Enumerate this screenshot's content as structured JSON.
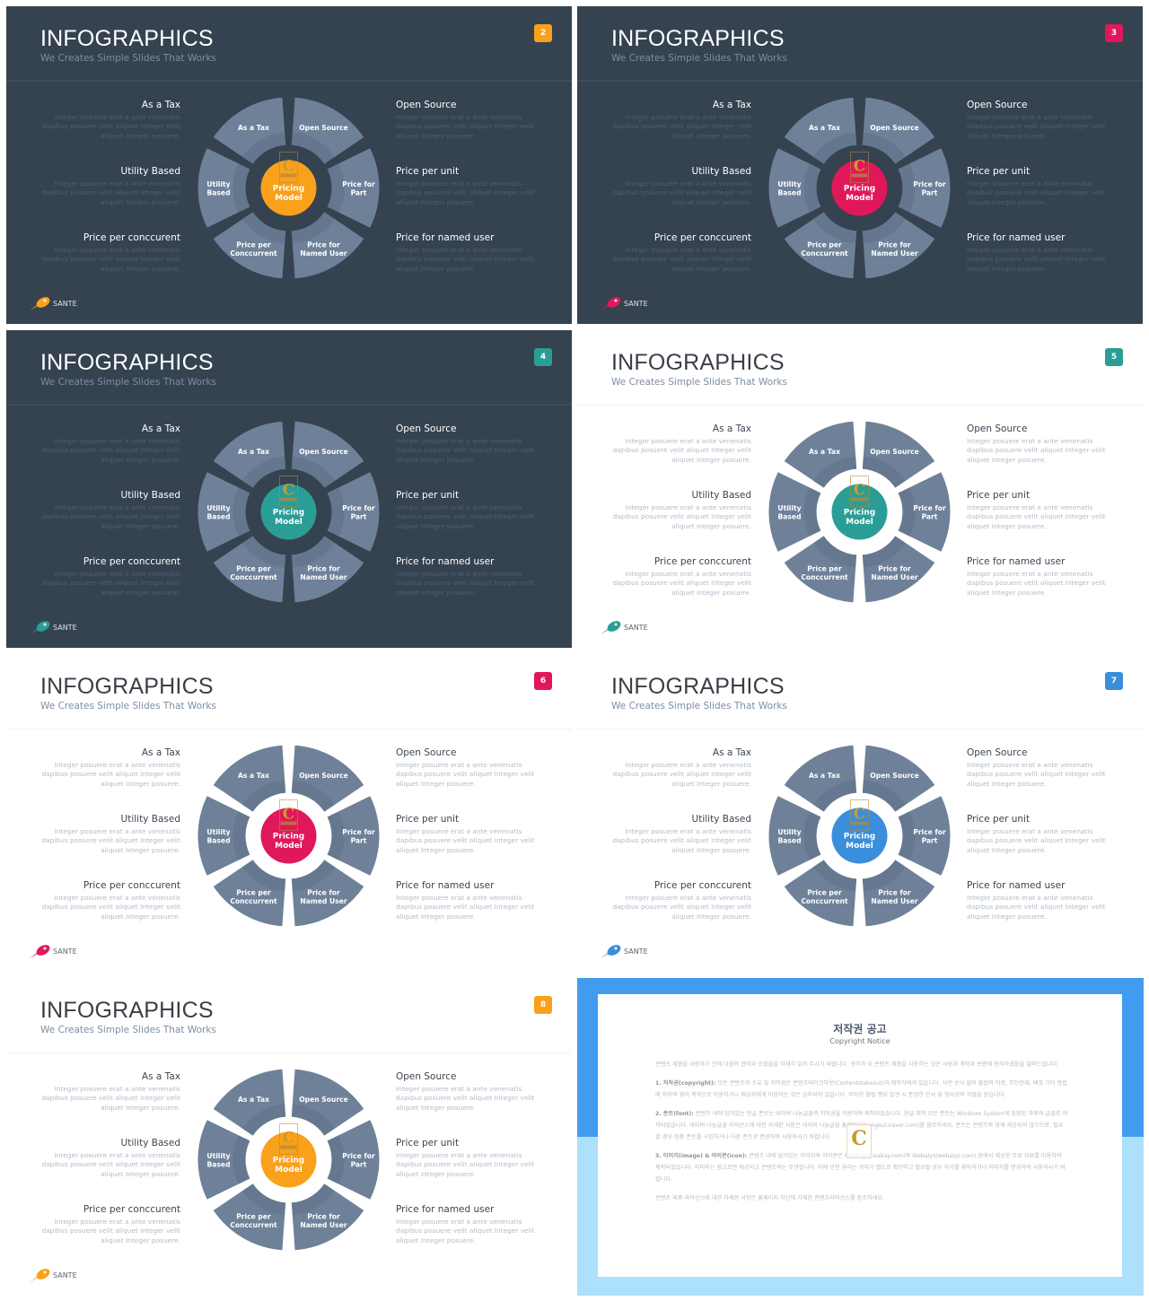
{
  "deck": {
    "segment_color": "#6E8199",
    "dark_bg": "#354250",
    "logo_c_color": "#C99A32"
  },
  "slides": [
    {
      "number": "2",
      "theme": "dark",
      "accent": "#F9A11B",
      "title": "INFOGRAPHICS",
      "subtitle": "We Creates Simple Slides That Works",
      "center_label": [
        "Pricing",
        "Model"
      ],
      "segments": [
        {
          "label": [
            "As a Tax"
          ]
        },
        {
          "label": [
            "Open Source"
          ]
        },
        {
          "label": [
            "Price for",
            "Part"
          ]
        },
        {
          "label": [
            "Price for",
            "Named User"
          ]
        },
        {
          "label": [
            "Price per",
            "Conccurrent"
          ]
        },
        {
          "label": [
            "Utility",
            "Based"
          ]
        }
      ],
      "left_items": [
        {
          "heading": "As a Tax",
          "body": "Integer posuere erat a ante venenatis dapibus posuere velit aliquet Integer velit aliquet Integer posuere."
        },
        {
          "heading": "Utility Based",
          "body": "Integer posuere erat a ante venenatis dapibus posuere velit aliquet Integer velit aliquet Integer posuere."
        },
        {
          "heading": "Price per conccurent",
          "body": "Integer posuere erat a ante venenatis dapibus posuere velit aliquet Integer velit aliquet Integer posuere."
        }
      ],
      "right_items": [
        {
          "heading": "Open Source",
          "body": "Integer posuere erat a ante venenatis dapibus posuere velit aliquet Integer velit aliquet Integer posuere."
        },
        {
          "heading": "Price per unit",
          "body": "Integer posuere erat a ante venenatis dapibus posuere velit aliquet Integer velit aliquet Integer posuere."
        },
        {
          "heading": "Price for named user",
          "body": "Integer posuere erat a ante venenatis dapibus posuere velit aliquet Integer velit aliquet Integer posuere."
        }
      ],
      "brand": "SANTE"
    },
    {
      "number": "3",
      "theme": "dark",
      "accent": "#E0185A",
      "title": "INFOGRAPHICS",
      "subtitle": "We Creates Simple Slides That Works",
      "center_label": [
        "Pricing",
        "Model"
      ],
      "segments": [
        {
          "label": [
            "As a Tax"
          ]
        },
        {
          "label": [
            "Open Source"
          ]
        },
        {
          "label": [
            "Price for",
            "Part"
          ]
        },
        {
          "label": [
            "Price for",
            "Named User"
          ]
        },
        {
          "label": [
            "Price per",
            "Conccurrent"
          ]
        },
        {
          "label": [
            "Utility",
            "Based"
          ]
        }
      ],
      "left_items": [
        {
          "heading": "As a Tax",
          "body": "Integer posuere erat a ante venenatis dapibus posuere velit aliquet Integer velit aliquet Integer posuere."
        },
        {
          "heading": "Utility Based",
          "body": "Integer posuere erat a ante venenatis dapibus posuere velit aliquet Integer velit aliquet Integer posuere."
        },
        {
          "heading": "Price per conccurent",
          "body": "Integer posuere erat a ante venenatis dapibus posuere velit aliquet Integer velit aliquet Integer posuere."
        }
      ],
      "right_items": [
        {
          "heading": "Open Source",
          "body": "Integer posuere erat a ante venenatis dapibus posuere velit aliquet Integer velit aliquet Integer posuere."
        },
        {
          "heading": "Price per unit",
          "body": "Integer posuere erat a ante venenatis dapibus posuere velit aliquet Integer velit aliquet Integer posuere."
        },
        {
          "heading": "Price for named user",
          "body": "Integer posuere erat a ante venenatis dapibus posuere velit aliquet Integer velit aliquet Integer posuere."
        }
      ],
      "brand": "SANTE"
    },
    {
      "number": "4",
      "theme": "dark",
      "accent": "#2A9D96",
      "title": "INFOGRAPHICS",
      "subtitle": "We Creates Simple Slides That Works",
      "center_label": [
        "Pricing",
        "Model"
      ],
      "segments": [
        {
          "label": [
            "As a Tax"
          ]
        },
        {
          "label": [
            "Open Source"
          ]
        },
        {
          "label": [
            "Price for",
            "Part"
          ]
        },
        {
          "label": [
            "Price for",
            "Named User"
          ]
        },
        {
          "label": [
            "Price per",
            "Conccurrent"
          ]
        },
        {
          "label": [
            "Utility",
            "Based"
          ]
        }
      ],
      "left_items": [
        {
          "heading": "As a Tax",
          "body": "Integer posuere erat a ante venenatis dapibus posuere velit aliquet Integer velit aliquet Integer posuere."
        },
        {
          "heading": "Utility Based",
          "body": "Integer posuere erat a ante venenatis dapibus posuere velit aliquet Integer velit aliquet Integer posuere."
        },
        {
          "heading": "Price per conccurent",
          "body": "Integer posuere erat a ante venenatis dapibus posuere velit aliquet Integer velit aliquet Integer posuere."
        }
      ],
      "right_items": [
        {
          "heading": "Open Source",
          "body": "Integer posuere erat a ante venenatis dapibus posuere velit aliquet Integer velit aliquet Integer posuere."
        },
        {
          "heading": "Price per unit",
          "body": "Integer posuere erat a ante venenatis dapibus posuere velit aliquet Integer velit aliquet Integer posuere."
        },
        {
          "heading": "Price for named user",
          "body": "Integer posuere erat a ante venenatis dapibus posuere velit aliquet Integer velit aliquet Integer posuere."
        }
      ],
      "brand": "SANTE"
    },
    {
      "number": "5",
      "theme": "light",
      "accent": "#2A9D96",
      "title": "INFOGRAPHICS",
      "subtitle": "We Creates Simple Slides That Works",
      "center_label": [
        "Pricing",
        "Model"
      ],
      "segments": [
        {
          "label": [
            "As a Tax"
          ]
        },
        {
          "label": [
            "Open Source"
          ]
        },
        {
          "label": [
            "Price for",
            "Part"
          ]
        },
        {
          "label": [
            "Price for",
            "Named User"
          ]
        },
        {
          "label": [
            "Price per",
            "Conccurrent"
          ]
        },
        {
          "label": [
            "Utility",
            "Based"
          ]
        }
      ],
      "left_items": [
        {
          "heading": "As a Tax",
          "body": "Integer posuere erat a ante venenatis dapibus posuere velit aliquet Integer velit aliquet Integer posuere."
        },
        {
          "heading": "Utility Based",
          "body": "Integer posuere erat a ante venenatis dapibus posuere velit aliquet Integer velit aliquet Integer posuere."
        },
        {
          "heading": "Price per conccurent",
          "body": "Integer posuere erat a ante venenatis dapibus posuere velit aliquet Integer velit aliquet Integer posuere."
        }
      ],
      "right_items": [
        {
          "heading": "Open Source",
          "body": "Integer posuere erat a ante venenatis dapibus posuere velit aliquet Integer velit aliquet Integer posuere."
        },
        {
          "heading": "Price per unit",
          "body": "Integer posuere erat a ante venenatis dapibus posuere velit aliquet Integer velit aliquet Integer posuere."
        },
        {
          "heading": "Price for named user",
          "body": "Integer posuere erat a ante venenatis dapibus posuere velit aliquet Integer velit aliquet Integer posuere."
        }
      ],
      "brand": "SANTE"
    },
    {
      "number": "6",
      "theme": "light",
      "accent": "#E0185A",
      "title": "INFOGRAPHICS",
      "subtitle": "We Creates Simple Slides That Works",
      "center_label": [
        "Pricing",
        "Model"
      ],
      "segments": [
        {
          "label": [
            "As a Tax"
          ]
        },
        {
          "label": [
            "Open Source"
          ]
        },
        {
          "label": [
            "Price for",
            "Part"
          ]
        },
        {
          "label": [
            "Price for",
            "Named User"
          ]
        },
        {
          "label": [
            "Price per",
            "Conccurrent"
          ]
        },
        {
          "label": [
            "Utility",
            "Based"
          ]
        }
      ],
      "left_items": [
        {
          "heading": "As a Tax",
          "body": "Integer posuere erat a ante venenatis dapibus posuere velit aliquet Integer velit aliquet Integer posuere."
        },
        {
          "heading": "Utility Based",
          "body": "Integer posuere erat a ante venenatis dapibus posuere velit aliquet Integer velit aliquet Integer posuere."
        },
        {
          "heading": "Price per conccurent",
          "body": "Integer posuere erat a ante venenatis dapibus posuere velit aliquet Integer velit aliquet Integer posuere."
        }
      ],
      "right_items": [
        {
          "heading": "Open Source",
          "body": "Integer posuere erat a ante venenatis dapibus posuere velit aliquet Integer velit aliquet Integer posuere."
        },
        {
          "heading": "Price per unit",
          "body": "Integer posuere erat a ante venenatis dapibus posuere velit aliquet Integer velit aliquet Integer posuere."
        },
        {
          "heading": "Price for named user",
          "body": "Integer posuere erat a ante venenatis dapibus posuere velit aliquet Integer velit aliquet Integer posuere."
        }
      ],
      "brand": "SANTE"
    },
    {
      "number": "7",
      "theme": "light",
      "accent": "#3A8EDB",
      "title": "INFOGRAPHICS",
      "subtitle": "We Creates Simple Slides That Works",
      "center_label": [
        "Pricing",
        "Model"
      ],
      "segments": [
        {
          "label": [
            "As a Tax"
          ]
        },
        {
          "label": [
            "Open Source"
          ]
        },
        {
          "label": [
            "Price for",
            "Part"
          ]
        },
        {
          "label": [
            "Price for",
            "Named User"
          ]
        },
        {
          "label": [
            "Price per",
            "Conccurrent"
          ]
        },
        {
          "label": [
            "Utility",
            "Based"
          ]
        }
      ],
      "left_items": [
        {
          "heading": "As a Tax",
          "body": "Integer posuere erat a ante venenatis dapibus posuere velit aliquet Integer velit aliquet Integer posuere."
        },
        {
          "heading": "Utility Based",
          "body": "Integer posuere erat a ante venenatis dapibus posuere velit aliquet Integer velit aliquet Integer posuere."
        },
        {
          "heading": "Price per conccurent",
          "body": "Integer posuere erat a ante venenatis dapibus posuere velit aliquet Integer velit aliquet Integer posuere."
        }
      ],
      "right_items": [
        {
          "heading": "Open Source",
          "body": "Integer posuere erat a ante venenatis dapibus posuere velit aliquet Integer velit aliquet Integer posuere."
        },
        {
          "heading": "Price per unit",
          "body": "Integer posuere erat a ante venenatis dapibus posuere velit aliquet Integer velit aliquet Integer posuere."
        },
        {
          "heading": "Price for named user",
          "body": "Integer posuere erat a ante venenatis dapibus posuere velit aliquet Integer velit aliquet Integer posuere."
        }
      ],
      "brand": "SANTE"
    },
    {
      "number": "8",
      "theme": "light",
      "accent": "#F9A11B",
      "title": "INFOGRAPHICS",
      "subtitle": "We Creates Simple Slides That Works",
      "center_label": [
        "Pricing",
        "Model"
      ],
      "segments": [
        {
          "label": [
            "As a Tax"
          ]
        },
        {
          "label": [
            "Open Source"
          ]
        },
        {
          "label": [
            "Price for",
            "Part"
          ]
        },
        {
          "label": [
            "Price for",
            "Named User"
          ]
        },
        {
          "label": [
            "Price per",
            "Conccurrent"
          ]
        },
        {
          "label": [
            "Utility",
            "Based"
          ]
        }
      ],
      "left_items": [
        {
          "heading": "As a Tax",
          "body": "Integer posuere erat a ante venenatis dapibus posuere velit aliquet Integer velit aliquet Integer posuere."
        },
        {
          "heading": "Utility Based",
          "body": "Integer posuere erat a ante venenatis dapibus posuere velit aliquet Integer velit aliquet Integer posuere."
        },
        {
          "heading": "Price per conccurent",
          "body": "Integer posuere erat a ante venenatis dapibus posuere velit aliquet Integer velit aliquet Integer posuere."
        }
      ],
      "right_items": [
        {
          "heading": "Open Source",
          "body": "Integer posuere erat a ante venenatis dapibus posuere velit aliquet Integer velit aliquet Integer posuere."
        },
        {
          "heading": "Price per unit",
          "body": "Integer posuere erat a ante venenatis dapibus posuere velit aliquet Integer velit aliquet Integer posuere."
        },
        {
          "heading": "Price for named user",
          "body": "Integer posuere erat a ante venenatis dapibus posuere velit aliquet Integer velit aliquet Integer posuere."
        }
      ],
      "brand": "SANTE"
    }
  ],
  "notice": {
    "title": "저작권 공고",
    "subtitle": "Copyright Notice",
    "intro": "콘텐츠 제품을 사용하기 전에 다음의 협약과 조항들을 자세히 읽어 주시기 바랍니다. 귀하가 이 콘텐츠 제품을 사용하는 것은 사용자 계약과 보증에 동의하셨음을 알려드립니다.",
    "sections": [
      {
        "label": "1. 저작권(copyright):",
        "text": "모든 콘텐츠의 소유 및 저작권은 콘텐츠테이크아웃(Contentstakeout)과 제작자에게 있습니다. 사전 승낙 없이 불법적 이용, 무단전재, 배포 기타 방법에 의하여 영리 목적으로 이용하거나 제삼자에게 이용하는 것은 금지되어 있습니다. 이러한 불법 행위 발견 시 준엄한 민사 및 형사상의 처벌을 받습니다."
      },
      {
        "label": "2. 폰트(font):",
        "text": "콘텐츠 내에 담겨있는 한글 폰트는 네이버 나눔글꼴의 저작권을 이용하여 제작되었습니다. 한글 외의 모든 폰트는 Windows System에 포함된 자체의 글꼴로 제작되었습니다. 네이버 나눔글꼴 라이선스에 대한 자세한 사항은 네이버 나눔글꼴 홈페이지(hangeul.naver.com)를 참조하세요. 폰트는 콘텐츠와 함께 제공되지 않으므로, 필요할 경우 정품 폰트를 구입하거나 다른 폰트로 변경하여 사용하시기 바랍니다."
      },
      {
        "label": "3. 이미지(image) & 아이콘(icon):",
        "text": "콘텐츠 내에 담겨있는 이미지와 아이콘은 Pixabay(pixabay.com)와 Webalys(webalys.com) 등에서 제공한 무료 자료를 이용하여 제작되었습니다. 이미지는 참고로만 제공되고 콘텐츠와는 무관합니다. 이에 관한 권리는 귀하가 별도로 확인하고 필요할 경우 허가를 취득하거나 이미지를 변경하여 사용하시기 바랍니다."
      }
    ],
    "footer": "콘텐츠 제품 라이선스에 대한 자세한 사항은 홈페이지 하단에 기재한 콘텐츠라이선스를 참조하세요.",
    "logo_letter": "C"
  }
}
